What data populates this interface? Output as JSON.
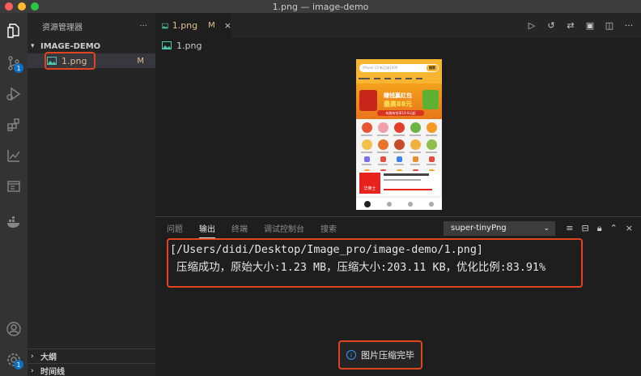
{
  "window": {
    "title": "1.png — image-demo"
  },
  "activity_bar": {
    "scm_badge": "1",
    "settings_badge": "1"
  },
  "sidebar": {
    "header": "资源管理器",
    "more": "···",
    "project": "IMAGE-DEMO",
    "file": {
      "name": "1.png",
      "status": "M"
    },
    "outline": "大纲",
    "timeline": "时间线"
  },
  "editor": {
    "tab": {
      "label": "1.png",
      "status": "M",
      "close": "×"
    },
    "breadcrumb": "1.png",
    "preview": {
      "search_placeholder": "iPhone 12 新品减1000",
      "search_button": "搜索",
      "banner_line1": "赚钱赢红包",
      "banner_line2": "最高88元",
      "banner_tag": "有路有钱享19.9元起",
      "card_logo": "华莱士"
    }
  },
  "panel": {
    "tabs": [
      "问题",
      "输出",
      "终端",
      "调试控制台",
      "搜索"
    ],
    "active_tab": "输出",
    "channel": "super-tinyPng",
    "output_lines": [
      "[/Users/didi/Desktop/Image_pro/image-demo/1.png]",
      " 压缩成功，原始大小:1.23 MB，压缩大小:203.11 KB，优化比例:83.91%"
    ]
  },
  "notification": {
    "message": "图片压缩完毕"
  },
  "colors": {
    "highlight": "#e0451f",
    "modified": "#e2c08d",
    "badge": "#0e70c0"
  }
}
